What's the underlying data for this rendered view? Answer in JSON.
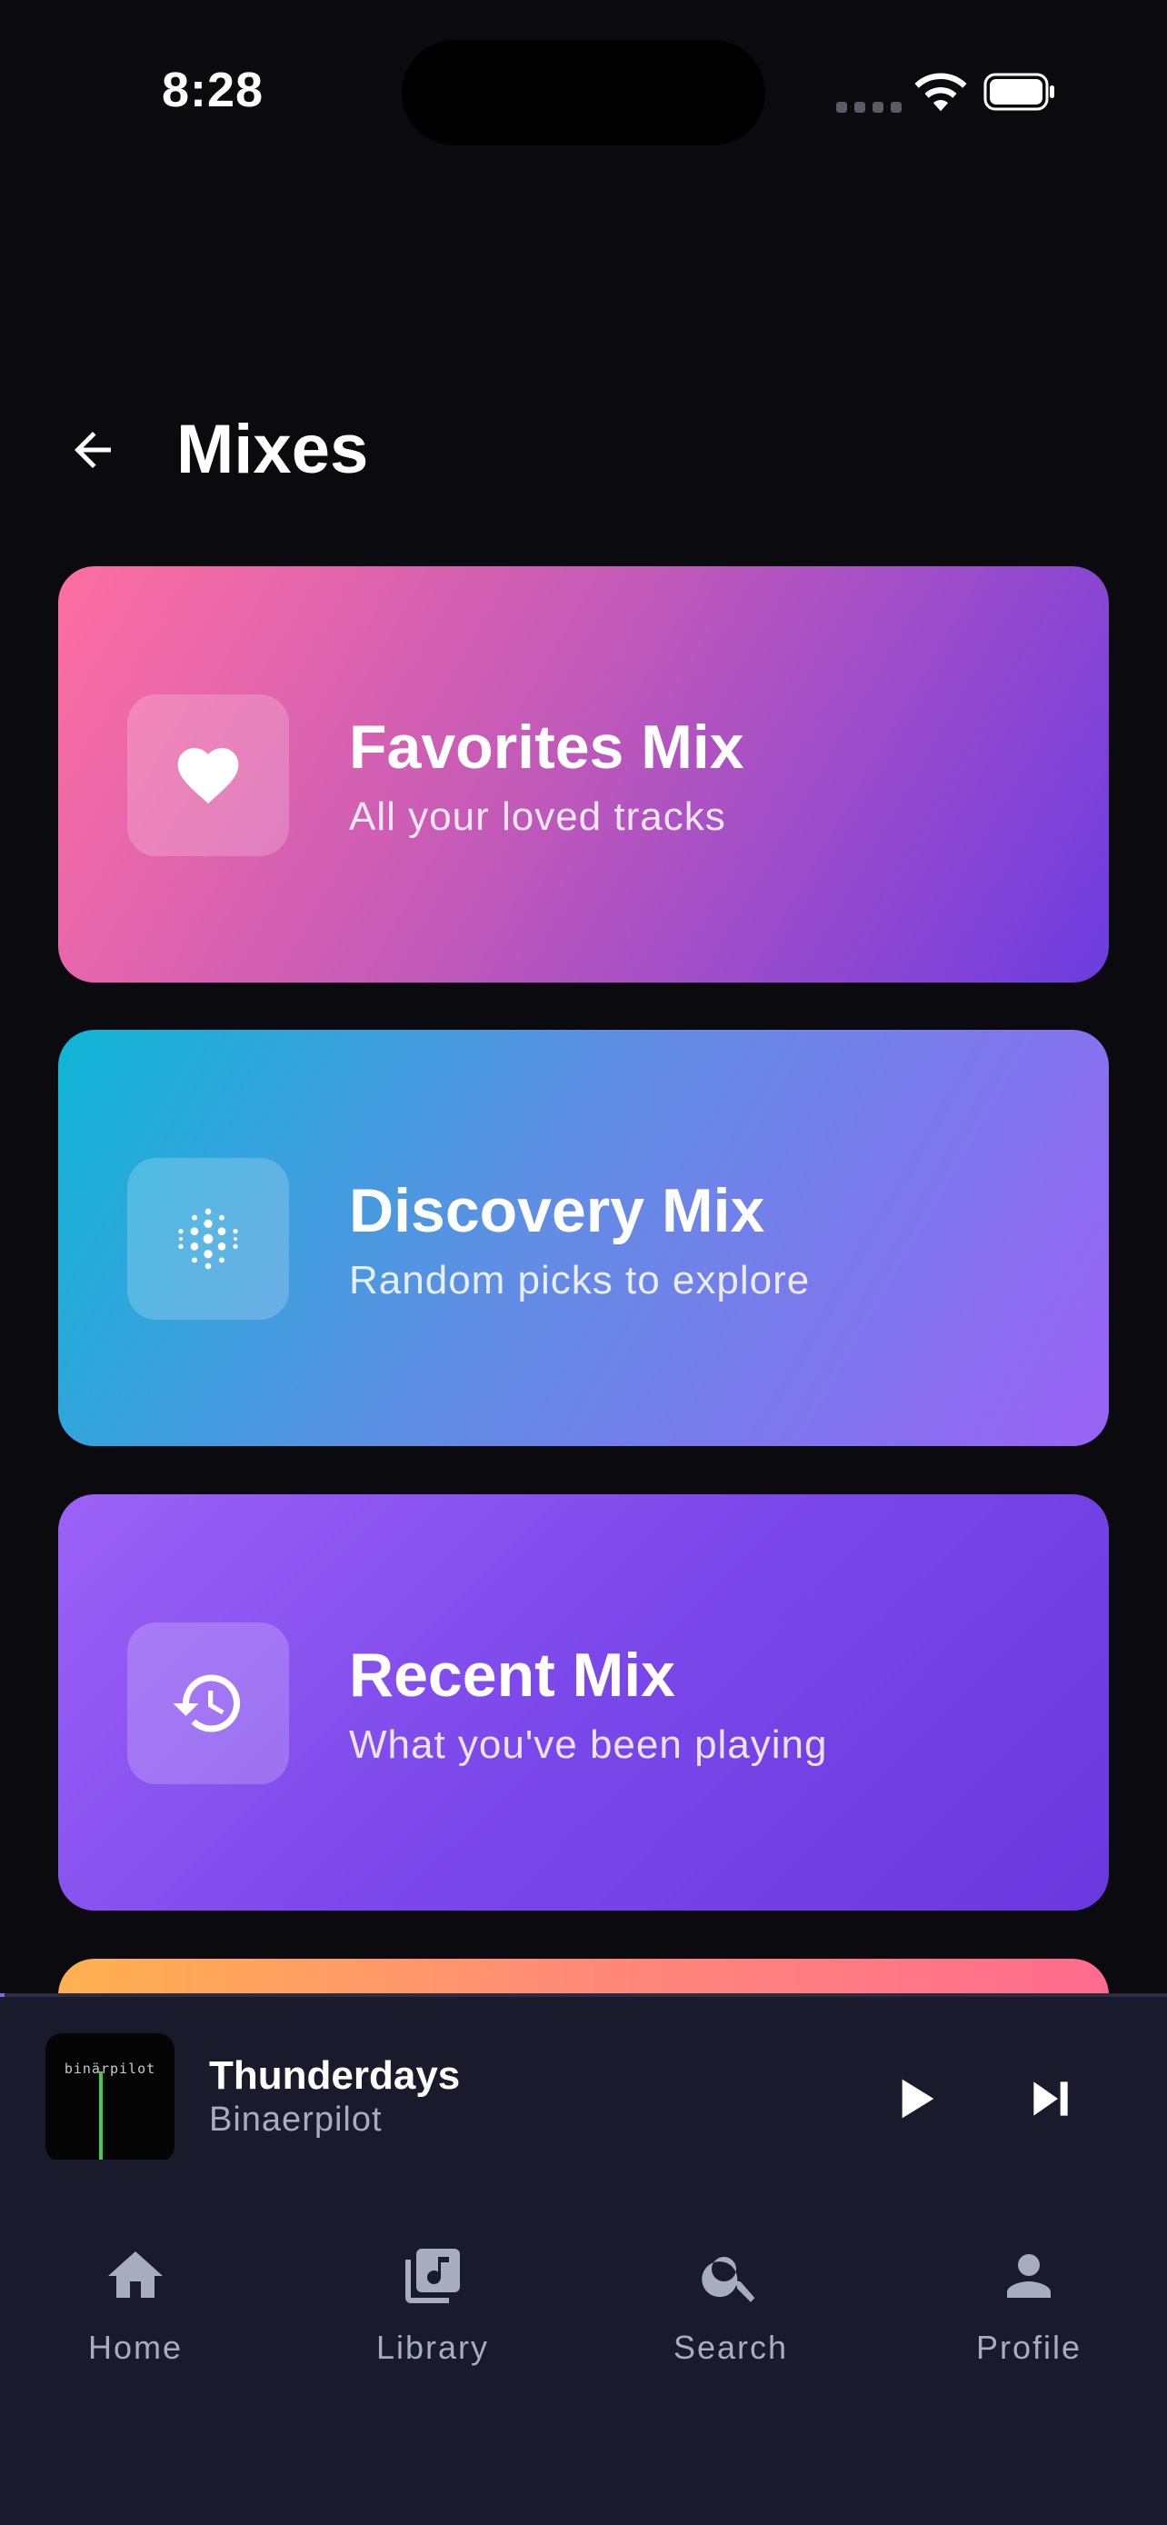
{
  "status_bar": {
    "time": "8:28"
  },
  "header": {
    "title": "Mixes"
  },
  "mixes": [
    {
      "title": "Favorites Mix",
      "subtitle": "All your loved tracks",
      "icon": "heart-icon"
    },
    {
      "title": "Discovery Mix",
      "subtitle": "Random picks to explore",
      "icon": "discovery-dots-icon"
    },
    {
      "title": "Recent Mix",
      "subtitle": "What you've been playing",
      "icon": "history-icon"
    }
  ],
  "now_playing": {
    "title": "Thunderdays",
    "artist": "Binaerpilot",
    "album_art_text": "binärpilot",
    "progress_fraction": 0.004
  },
  "nav": {
    "items": [
      {
        "label": "Home",
        "icon": "home-icon"
      },
      {
        "label": "Library",
        "icon": "library-music-icon"
      },
      {
        "label": "Search",
        "icon": "search-icon"
      },
      {
        "label": "Profile",
        "icon": "person-icon"
      }
    ]
  },
  "colors": {
    "background": "#0b0b0f",
    "panel": "#191a2c",
    "accent": "#8b5cf6",
    "favorites_gradient": [
      "#ff6fa1",
      "#6c3ce0"
    ],
    "discovery_gradient": [
      "#0fb6d6",
      "#9a62f5"
    ],
    "recent_gradient": [
      "#9c62f7",
      "#6a38de"
    ]
  }
}
